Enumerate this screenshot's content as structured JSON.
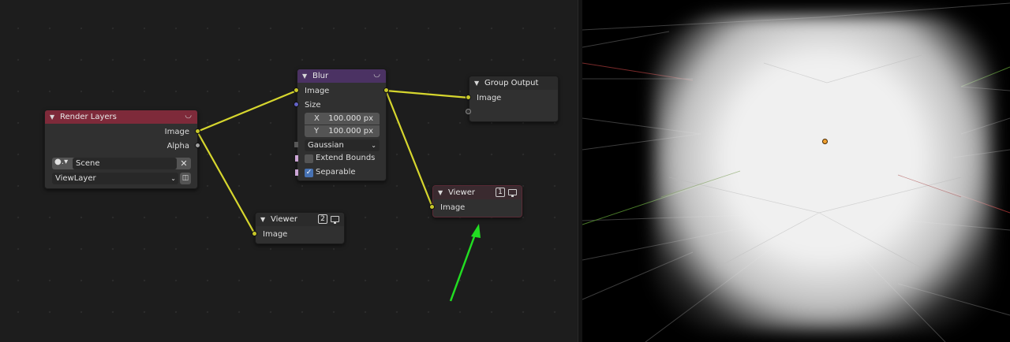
{
  "nodes": {
    "render_layers": {
      "title": "Render Layers",
      "outputs": [
        "Image",
        "Alpha"
      ],
      "scene": "Scene",
      "view_layer": "ViewLayer",
      "header_color": "#7e2a3a"
    },
    "blur": {
      "title": "Blur",
      "inputs": [
        "Image",
        "Size"
      ],
      "size_x_label": "X",
      "size_x_value": "100.000 px",
      "size_y_label": "Y",
      "size_y_value": "100.000 px",
      "filter_type": "Gaussian",
      "extend_bounds_label": "Extend Bounds",
      "extend_bounds_checked": false,
      "separable_label": "Separable",
      "separable_checked": true,
      "header_color": "#4b3263"
    },
    "group_output": {
      "title": "Group Output",
      "inputs": [
        "Image"
      ]
    },
    "viewer_1": {
      "title": "Viewer",
      "badge": "1",
      "inputs": [
        "Image"
      ]
    },
    "viewer_2": {
      "title": "Viewer",
      "badge": "2",
      "inputs": [
        "Image"
      ]
    }
  },
  "colors": {
    "link": "#d6d62e",
    "annotation_arrow": "#22dd22",
    "socket_color": "#c7c729",
    "socket_float": "#a1a1a1",
    "socket_vector": "#6363c7"
  },
  "icons": {
    "node_collapse": "chevron-down-icon",
    "viewer_display": "monitor-icon",
    "scene_browse": "scene-data-icon",
    "clear": "close-icon",
    "view_layer_new": "new-layer-icon"
  }
}
